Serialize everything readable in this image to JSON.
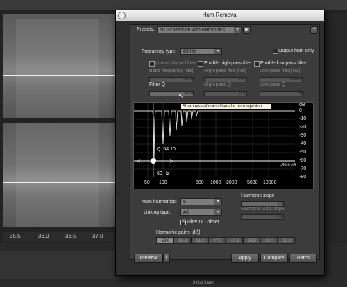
{
  "background": {
    "time_axis": [
      "35.5",
      "36.0",
      "36.5",
      "37.0"
    ],
    "status_text": "Initial State"
  },
  "dialog": {
    "title": "Hum Removal",
    "presets_label": "Presets:",
    "preset_value": "60 Hz Reduce with Harmonics",
    "help_label": "?",
    "frequency_type_label": "Frequency type:",
    "frequency_type_value": "60 Hz",
    "output_hum_only_label": "Output hum only",
    "linear_phase_label": "Linear-phase filters",
    "enable_highpass_label": "Enable high-pass filter",
    "enable_lowpass_label": "Enable low-pass filter",
    "base_freq_label": "Base frequency [Hz]",
    "base_freq_value": "60.00",
    "highpass_freq_label": "High-pass freq [Hz]",
    "highpass_freq_value": "20.00",
    "lowpass_freq_label": "Low-pass freq [Hz]",
    "lowpass_freq_value": "20000.0",
    "filter_q_label": "Filter Q",
    "filter_q_value": "54.10",
    "highpass_q_label": "High-pass Q",
    "highpass_q_value": "0.30",
    "lowpass_q_label": "Low-pass Q",
    "lowpass_q_value": "1.00",
    "tooltip": "Sharpness of notch filters for hum rejection",
    "graph": {
      "q_readout": "Q: 54.10",
      "freq_readout": "60 Hz",
      "db_readout": "-59.9 dB",
      "db_ticks": [
        "dB",
        "0",
        "-10",
        "-20",
        "-30",
        "-40",
        "-50",
        "-60",
        "-70",
        "-80"
      ],
      "freq_ticks": [
        "50",
        "100",
        "500",
        "1000",
        "2000",
        "5000",
        "10000"
      ]
    },
    "num_harmonics_label": "Num harmonics:",
    "num_harmonics_value": "8",
    "linking_type_label": "Linking type:",
    "linking_type_value": "All",
    "filter_dc_label": "Filter DC offset",
    "harmonic_slope_label": "Harmonic slope",
    "harmonic_slope_value": "0.5",
    "harmonic_odd_slope_label": "Harmonic odd slope",
    "harmonic_odd_slope_value": "0.00",
    "harmonic_gains_label": "Harmonic gains [dB]",
    "harmonic_gains": [
      "-59.9",
      "-55.6",
      "-51.3",
      "-47.0",
      "-42.8",
      "-38.5",
      "-34.2",
      "-29.9"
    ],
    "preview_label": "Preview",
    "apply_label": "Apply",
    "compare_label": "Compare",
    "batch_label": "Batch"
  }
}
